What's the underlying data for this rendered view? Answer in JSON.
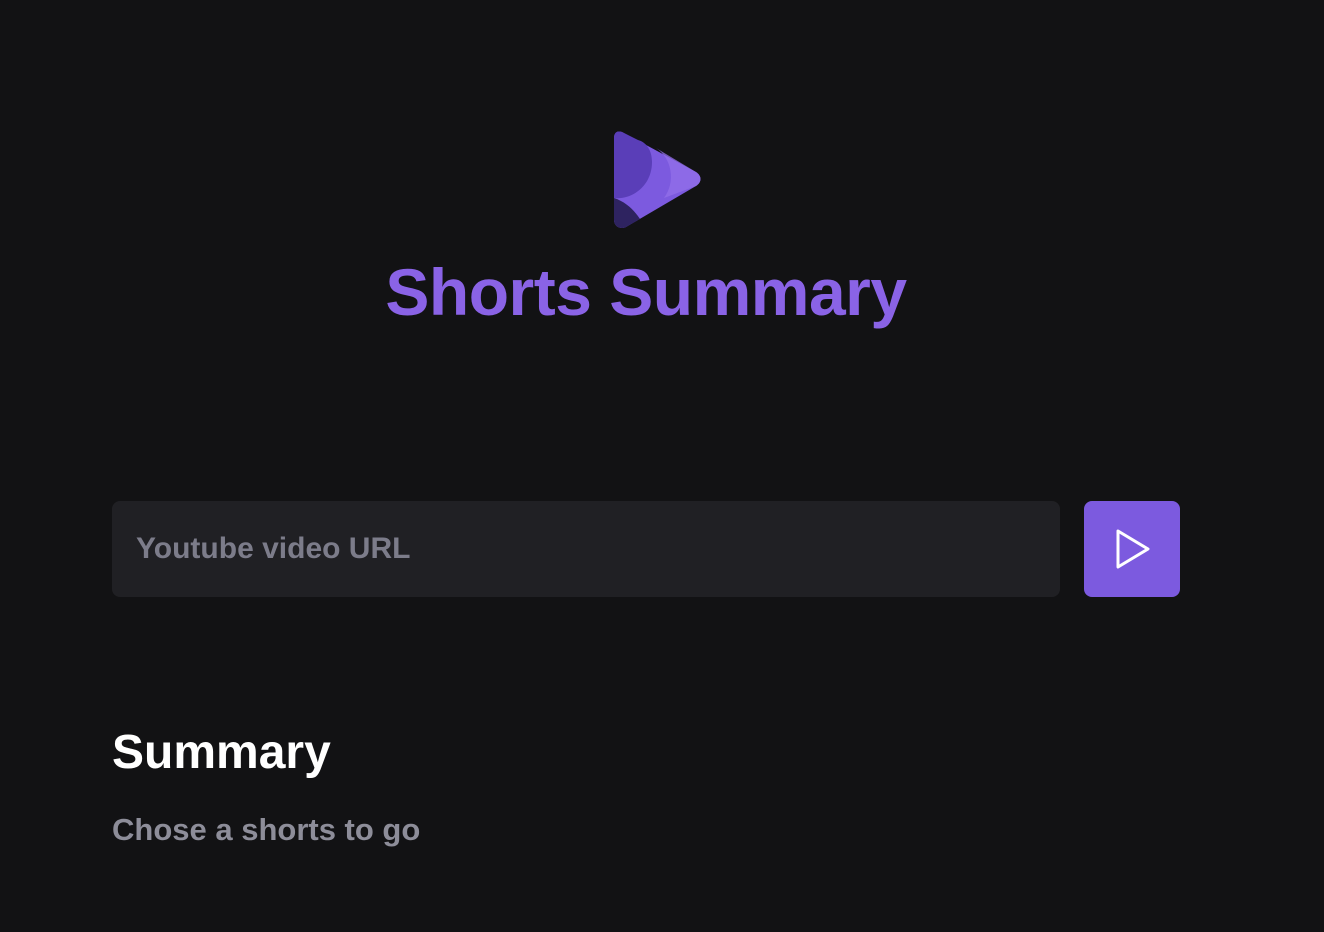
{
  "header": {
    "logo_icon": "play-triangle-logo-icon",
    "title": "Shorts Summary"
  },
  "search": {
    "placeholder": "Youtube video URL",
    "value": "",
    "submit_icon": "play-icon"
  },
  "summary": {
    "heading": "Summary",
    "text": "Chose a shorts to go"
  },
  "colors": {
    "background": "#121214",
    "accent": "#8a63e6",
    "button": "#7c5adf",
    "input_background": "#202024",
    "muted_text": "#8d8d99"
  }
}
